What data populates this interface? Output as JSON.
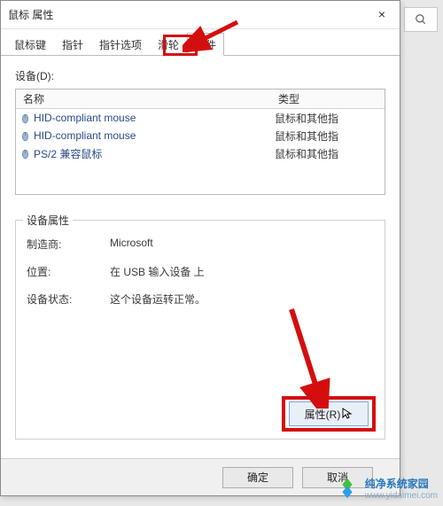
{
  "titlebar": {
    "title": "鼠标 属性",
    "close": "×"
  },
  "tabs": {
    "items": [
      {
        "label": "鼠标键"
      },
      {
        "label": "指针"
      },
      {
        "label": "指针选项"
      },
      {
        "label": "滑轮"
      },
      {
        "label": "硬件"
      }
    ],
    "active_index": 4
  },
  "devices_label": "设备(D):",
  "device_list": {
    "headers": {
      "name": "名称",
      "type": "类型"
    },
    "rows": [
      {
        "name": "HID-compliant mouse",
        "type": "鼠标和其他指"
      },
      {
        "name": "HID-compliant mouse",
        "type": "鼠标和其他指"
      },
      {
        "name": "PS/2 兼容鼠标",
        "type": "鼠标和其他指"
      }
    ]
  },
  "group": {
    "legend": "设备属性",
    "rows": [
      {
        "k": "制造商:",
        "v": "Microsoft"
      },
      {
        "k": "位置:",
        "v": "在 USB 输入设备 上"
      },
      {
        "k": "设备状态:",
        "v": "这个设备运转正常。"
      }
    ],
    "props_button": "属性(R)"
  },
  "footer": {
    "ok": "确定",
    "cancel": "取消"
  },
  "watermark": {
    "name": "纯净系统家园",
    "url": "www.yidaimei.com"
  },
  "colors": {
    "red": "#d40e0e",
    "link": "#284b86"
  }
}
